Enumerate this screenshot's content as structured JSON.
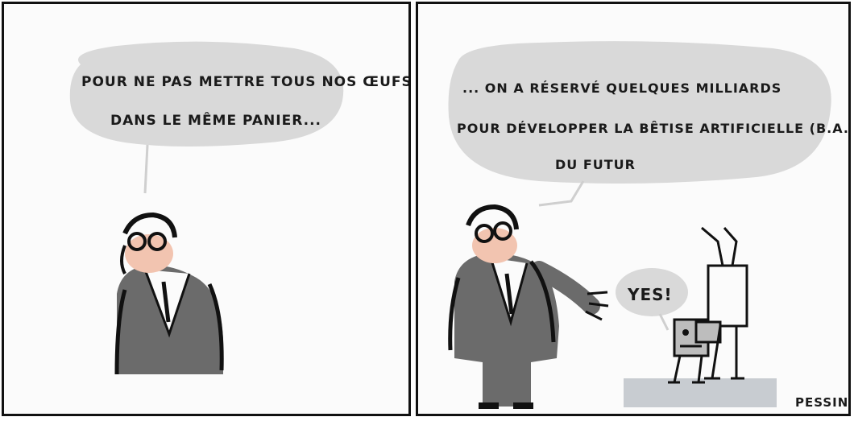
{
  "panels": [
    {
      "speech": {
        "line1": "POUR NE PAS METTRE TOUS NOS ŒUFS",
        "line2": "DANS LE MÊME PANIER..."
      }
    },
    {
      "speech": {
        "line1": "... ON A RÉSERVÉ QUELQUES MILLIARDS",
        "line2": "POUR DÉVELOPPER LA BÊTISE ARTIFICIELLE (B.A.)",
        "line3": "DU FUTUR"
      },
      "robot_speech": "YES!",
      "signature": "PESSIN"
    }
  ],
  "colors": {
    "bubble": "#d9d9d9",
    "suit": "#6b6b6b",
    "skin": "#f2c4b0",
    "ink": "#111111",
    "floor": "#c8ccd1"
  }
}
